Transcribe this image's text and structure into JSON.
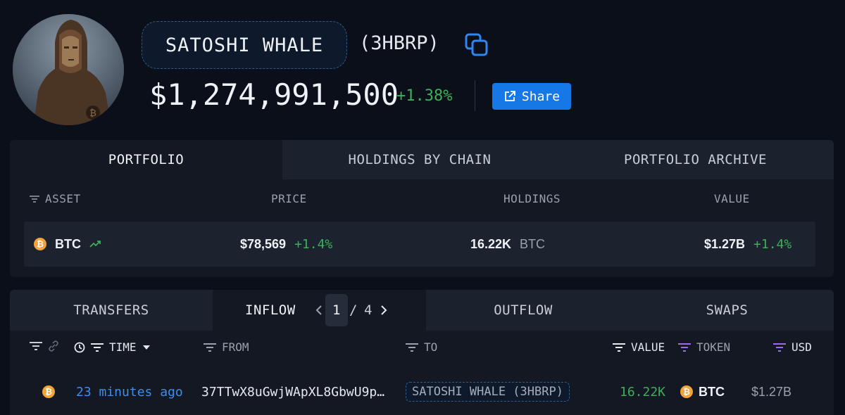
{
  "profile": {
    "entity_name": "SATOSHI WHALE",
    "entity_tag": "(3HBRP)",
    "total_value": "$1,274,991,500",
    "total_change": "+1.38%",
    "share_label": "Share"
  },
  "portfolio": {
    "tabs": [
      "PORTFOLIO",
      "HOLDINGS BY CHAIN",
      "PORTFOLIO ARCHIVE"
    ],
    "columns": {
      "asset": "ASSET",
      "price": "PRICE",
      "holdings": "HOLDINGS",
      "value": "VALUE"
    },
    "rows": [
      {
        "asset": "BTC",
        "coin_glyph": "₿",
        "price": "$78,569",
        "price_change": "+1.4%",
        "holdings": "16.22K",
        "holdings_unit": "BTC",
        "value": "$1.27B",
        "value_change": "+1.4%"
      }
    ]
  },
  "transfers": {
    "tabs": [
      "TRANSFERS",
      "INFLOW",
      "OUTFLOW",
      "SWAPS"
    ],
    "pager": {
      "current": "1",
      "separator": "/",
      "total": "4"
    },
    "columns": {
      "time": "TIME",
      "from": "FROM",
      "to": "TO",
      "value": "VALUE",
      "token": "TOKEN",
      "usd": "USD"
    },
    "rows": [
      {
        "coin_glyph": "₿",
        "time": "23 minutes ago",
        "from": "37TTwX8uGwjWApXL8GbwU9p…",
        "to": "SATOSHI WHALE (3HBRP)",
        "value": "16.22K",
        "token": "BTC",
        "usd": "$1.27B"
      }
    ]
  },
  "colors": {
    "accent": "#1677e6",
    "positive": "#3fae5a",
    "link": "#3a8ef0",
    "coin": "#f2a33a",
    "background": "#0b0f19"
  }
}
